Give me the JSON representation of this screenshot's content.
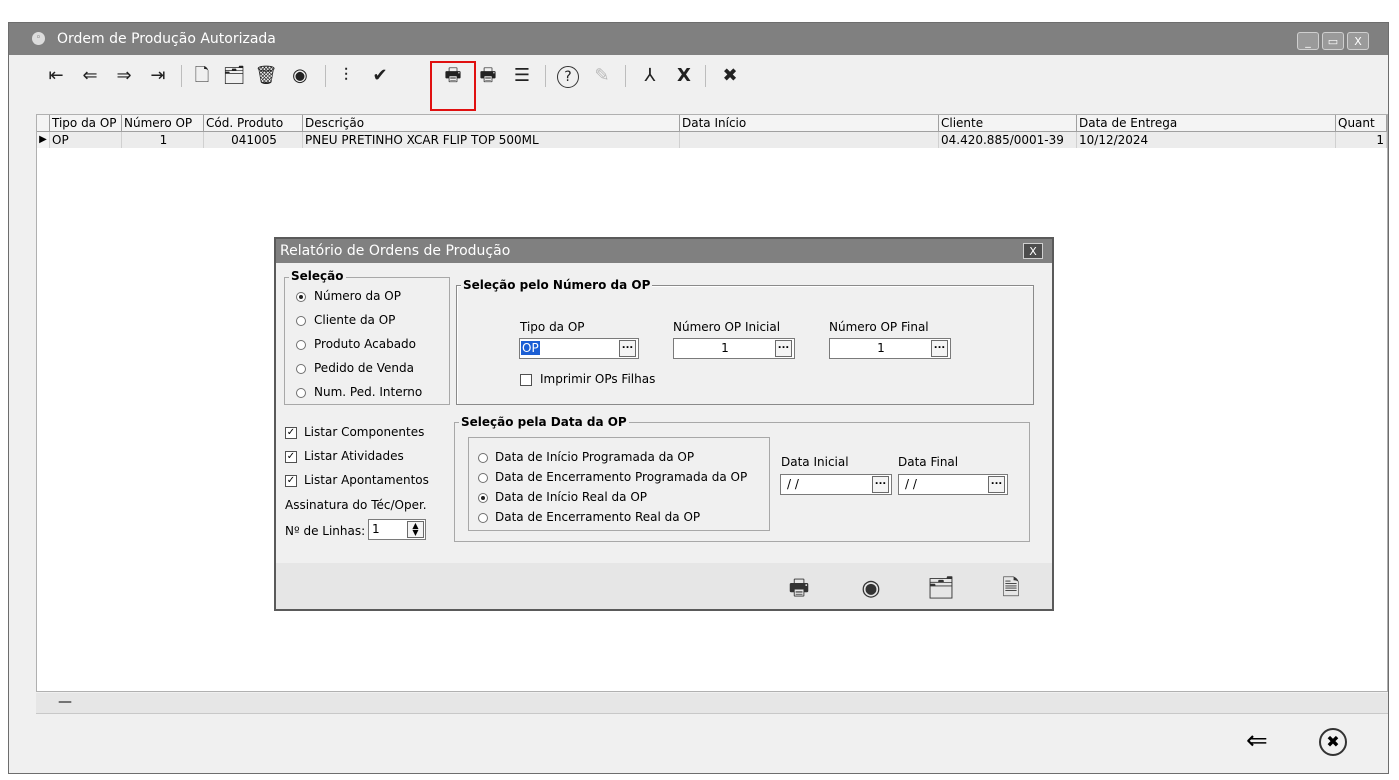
{
  "window": {
    "title": "Ordem de Produção Autorizada",
    "controls": [
      "_",
      "▭",
      "X"
    ]
  },
  "toolbar": {
    "icons": [
      "first-icon",
      "prev-icon",
      "next-icon",
      "last-icon",
      "new-doc-icon",
      "folder-icon",
      "trash-icon",
      "view-icon",
      "chart-icon",
      "check-icon",
      "print-icon",
      "print2-icon",
      "list-icon",
      "help-icon",
      "edit-disabled-icon",
      "pdf-icon",
      "excel-icon",
      "close-circle-icon"
    ],
    "glyphs": [
      "⇤",
      "⇐",
      "⇒",
      "⇥",
      "🗋",
      "🗂",
      "🗑",
      "◉",
      "⫶",
      "✔",
      "🖶",
      "🖶",
      "☰",
      "?",
      "✎",
      "⅄",
      "X",
      "✖"
    ]
  },
  "grid": {
    "columns": [
      "Tipo da OP",
      "Número OP",
      "Cód. Produto",
      "Descrição",
      "Data Início",
      "Cliente",
      "Data de Entrega",
      "Quant"
    ],
    "rows": [
      {
        "tipo": "OP",
        "numero": "1",
        "codigo": "041005",
        "descricao": "PNEU PRETINHO XCAR FLIP TOP 500ML",
        "data_inicio": "",
        "cliente": "04.420.885/0001-39",
        "entrega": "10/12/2024",
        "quant": "1"
      }
    ]
  },
  "dialog": {
    "title": "Relatório de Ordens de Produção",
    "close": "X",
    "selecao": {
      "title": "Seleção",
      "options": [
        "Número da OP",
        "Cliente da OP",
        "Produto Acabado",
        "Pedido de Venda",
        "Num. Ped. Interno"
      ],
      "selected_index": 0
    },
    "checks": {
      "listar_componentes": "Listar Componentes",
      "listar_atividades": "Listar Atividades",
      "listar_apontamentos": "Listar Apontamentos"
    },
    "assinatura_label": "Assinatura do Téc/Oper.",
    "linhas_label": "Nº de Linhas:",
    "linhas_value": "1",
    "numero_group": {
      "title": "Seleção pelo Número da OP",
      "tipo_label": "Tipo da OP",
      "tipo_value": "OP",
      "inicial_label": "Número OP Inicial",
      "inicial_value": "1",
      "final_label": "Número OP Final",
      "final_value": "1",
      "filhas_label": "Imprimir OPs Filhas"
    },
    "data_group": {
      "title": "Seleção pela Data da OP",
      "options": [
        "Data de Início Programada da OP",
        "Data de Encerramento Programada da OP",
        "Data de Início Real da OP",
        "Data de Encerramento Real da OP"
      ],
      "selected_index": 2,
      "data_inicial_label": "Data Inicial",
      "data_inicial_value": "/ /",
      "data_final_label": "Data Final",
      "data_final_value": "/ /"
    },
    "field_button": "...",
    "footer_icons": [
      "print-icon",
      "preview-icon",
      "folder-icon",
      "cancel-report-icon"
    ]
  },
  "bottom": {
    "status_text": "—",
    "back_glyph": "⇐",
    "close_glyph": "✖"
  }
}
